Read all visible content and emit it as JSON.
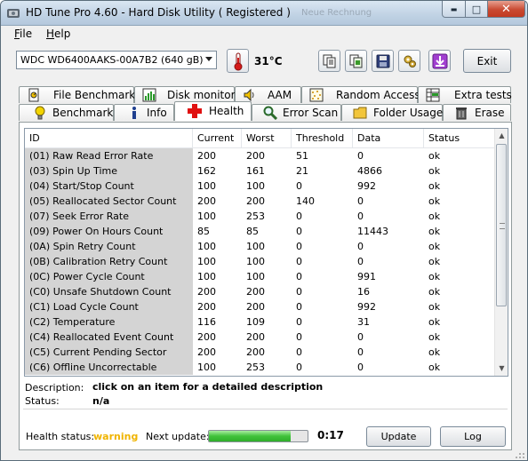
{
  "window": {
    "title": "HD Tune Pro 4.60 - Hard Disk Utility (  Registered )",
    "ghost_title": "Neue Rechnung",
    "min_glyph": "▬",
    "max_glyph": "□",
    "close_glyph": "✕"
  },
  "menu": [
    {
      "label": "File"
    },
    {
      "label": "Help"
    }
  ],
  "toolbar": {
    "drive": "WDC WD6400AAKS-00A7B2 (640 gB)",
    "temperature": "31°C",
    "exit_label": "Exit",
    "icons": [
      "copy-text-icon",
      "copy-screen-icon",
      "save-icon",
      "options-icon",
      "download-icon"
    ]
  },
  "tabs_top": [
    {
      "label": "File Benchmark",
      "icon": "file-benchmark-icon"
    },
    {
      "label": "Disk monitor",
      "icon": "disk-monitor-icon"
    },
    {
      "label": "AAM",
      "icon": "speaker-icon"
    },
    {
      "label": "Random Access",
      "icon": "random-access-icon"
    },
    {
      "label": "Extra tests",
      "icon": "extra-tests-icon"
    }
  ],
  "tabs_bottom": [
    {
      "label": "Benchmark",
      "icon": "lightbulb-icon"
    },
    {
      "label": "Info",
      "icon": "info-icon"
    },
    {
      "label": "Health",
      "icon": "health-cross-icon",
      "active": true
    },
    {
      "label": "Error Scan",
      "icon": "magnifier-icon"
    },
    {
      "label": "Folder Usage",
      "icon": "folder-icon"
    },
    {
      "label": "Erase",
      "icon": "trash-icon"
    }
  ],
  "table": {
    "columns": [
      "ID",
      "Current",
      "Worst",
      "Threshold",
      "Data",
      "Status"
    ],
    "rows": [
      [
        "(01) Raw Read Error Rate",
        "200",
        "200",
        "51",
        "0",
        "ok"
      ],
      [
        "(03) Spin Up Time",
        "162",
        "161",
        "21",
        "4866",
        "ok"
      ],
      [
        "(04) Start/Stop Count",
        "100",
        "100",
        "0",
        "992",
        "ok"
      ],
      [
        "(05) Reallocated Sector Count",
        "200",
        "200",
        "140",
        "0",
        "ok"
      ],
      [
        "(07) Seek Error Rate",
        "100",
        "253",
        "0",
        "0",
        "ok"
      ],
      [
        "(09) Power On Hours Count",
        "85",
        "85",
        "0",
        "11443",
        "ok"
      ],
      [
        "(0A) Spin Retry Count",
        "100",
        "100",
        "0",
        "0",
        "ok"
      ],
      [
        "(0B) Calibration Retry Count",
        "100",
        "100",
        "0",
        "0",
        "ok"
      ],
      [
        "(0C) Power Cycle Count",
        "100",
        "100",
        "0",
        "991",
        "ok"
      ],
      [
        "(C0) Unsafe Shutdown Count",
        "200",
        "200",
        "0",
        "16",
        "ok"
      ],
      [
        "(C1) Load Cycle Count",
        "200",
        "200",
        "0",
        "992",
        "ok"
      ],
      [
        "(C2) Temperature",
        "116",
        "109",
        "0",
        "31",
        "ok"
      ],
      [
        "(C4) Reallocated Event Count",
        "200",
        "200",
        "0",
        "0",
        "ok"
      ],
      [
        "(C5) Current Pending Sector",
        "200",
        "200",
        "0",
        "0",
        "ok"
      ],
      [
        "(C6) Offline Uncorrectable",
        "100",
        "253",
        "0",
        "0",
        "ok"
      ]
    ]
  },
  "details": {
    "description_label": "Description:",
    "description_value": "click on an item for a detailed description",
    "status_label": "Status:",
    "status_value": "n/a"
  },
  "footer": {
    "health_label": "Health status:",
    "health_value": "warning",
    "health_color": "#f0b400",
    "next_update_label": "Next update:",
    "progress_fraction": 0.83,
    "next_update_time": "0:17",
    "update_label": "Update",
    "log_label": "Log"
  }
}
